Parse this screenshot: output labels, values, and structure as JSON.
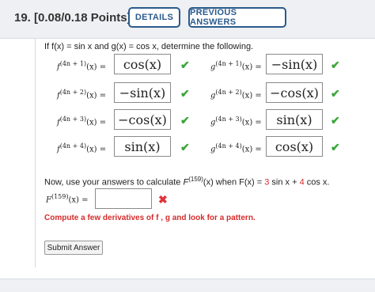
{
  "header": {
    "question_number": "19.",
    "points": "[0.08/0.18 Points]",
    "details_label": "DETAILS",
    "previous_answers_label": "PREVIOUS ANSWERS"
  },
  "prompt": "If f(x) = sin x and g(x) = cos x, determine the following.",
  "rows": [
    {
      "f_label_pre": "f",
      "f_sup": "(4n + 1)",
      "f_label_post": "(x) =",
      "f_answer": "cos(x)",
      "g_label_pre": "g",
      "g_sup": "(4n + 1)",
      "g_label_post": "(x) =",
      "g_answer": "−sin(x)"
    },
    {
      "f_label_pre": "f",
      "f_sup": "(4n + 2)",
      "f_label_post": "(x) =",
      "f_answer": "−sin(x)",
      "g_label_pre": "g",
      "g_sup": "(4n + 2)",
      "g_label_post": "(x) =",
      "g_answer": "−cos(x)"
    },
    {
      "f_label_pre": "f",
      "f_sup": "(4n + 3)",
      "f_label_post": "(x) =",
      "f_answer": "−cos(x)",
      "g_label_pre": "g",
      "g_sup": "(4n + 3)",
      "g_label_post": "(x) =",
      "g_answer": "sin(x)"
    },
    {
      "f_label_pre": "f",
      "f_sup": "(4n + 4)",
      "f_label_post": "(x) =",
      "f_answer": "sin(x)",
      "g_label_pre": "g",
      "g_sup": "(4n + 4)",
      "g_label_post": "(x) =",
      "g_answer": "cos(x)"
    }
  ],
  "instruction": {
    "pre": "Now, use your answers to calculate ",
    "F_label": "F",
    "F_sup": "(159)",
    "mid": "(x) when F(x) = ",
    "coef1": "3",
    "trig1": " sin x + ",
    "coef2": "4",
    "trig2": " cos x."
  },
  "final": {
    "label_pre": "F",
    "label_sup": "(159)",
    "label_post": "(x) =",
    "value": ""
  },
  "hint": "Compute a few derivatives of  f ,  g  and look for a pattern.",
  "submit_label": "Submit Answer",
  "colors": {
    "check": "#3aa63a",
    "cross": "#e0353b",
    "accent": "#2b5a8c",
    "hint": "#d62b2b"
  }
}
